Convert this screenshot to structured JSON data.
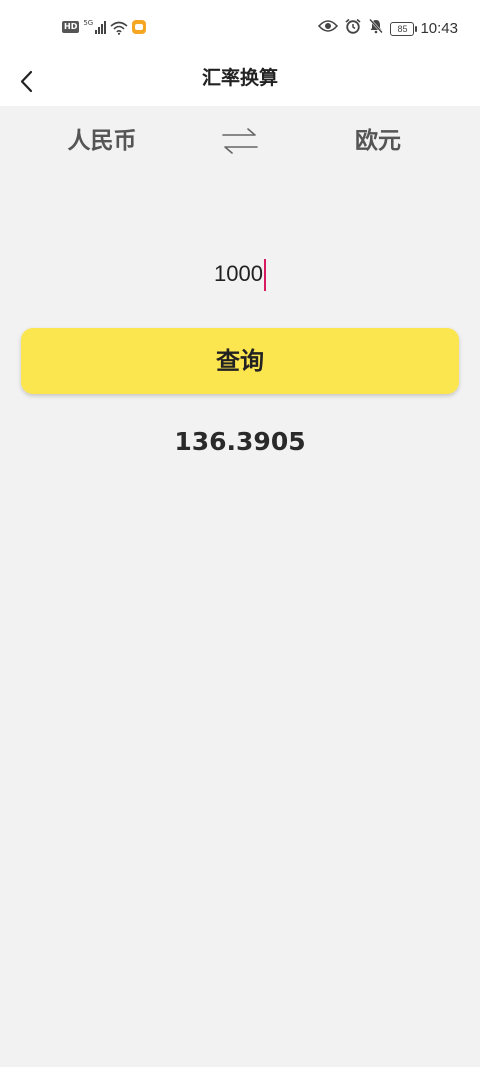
{
  "status_bar": {
    "hd": "HD",
    "network": "5G",
    "battery": "85",
    "time": "10:43"
  },
  "header": {
    "title": "汇率换算"
  },
  "currency": {
    "from": "人民币",
    "to": "欧元"
  },
  "input": {
    "amount": "1000"
  },
  "query_button": {
    "label": "查询"
  },
  "result": {
    "value": "136.3905"
  },
  "colors": {
    "accent": "#fce650",
    "caret": "#d81b60",
    "background": "#f2f2f2"
  }
}
